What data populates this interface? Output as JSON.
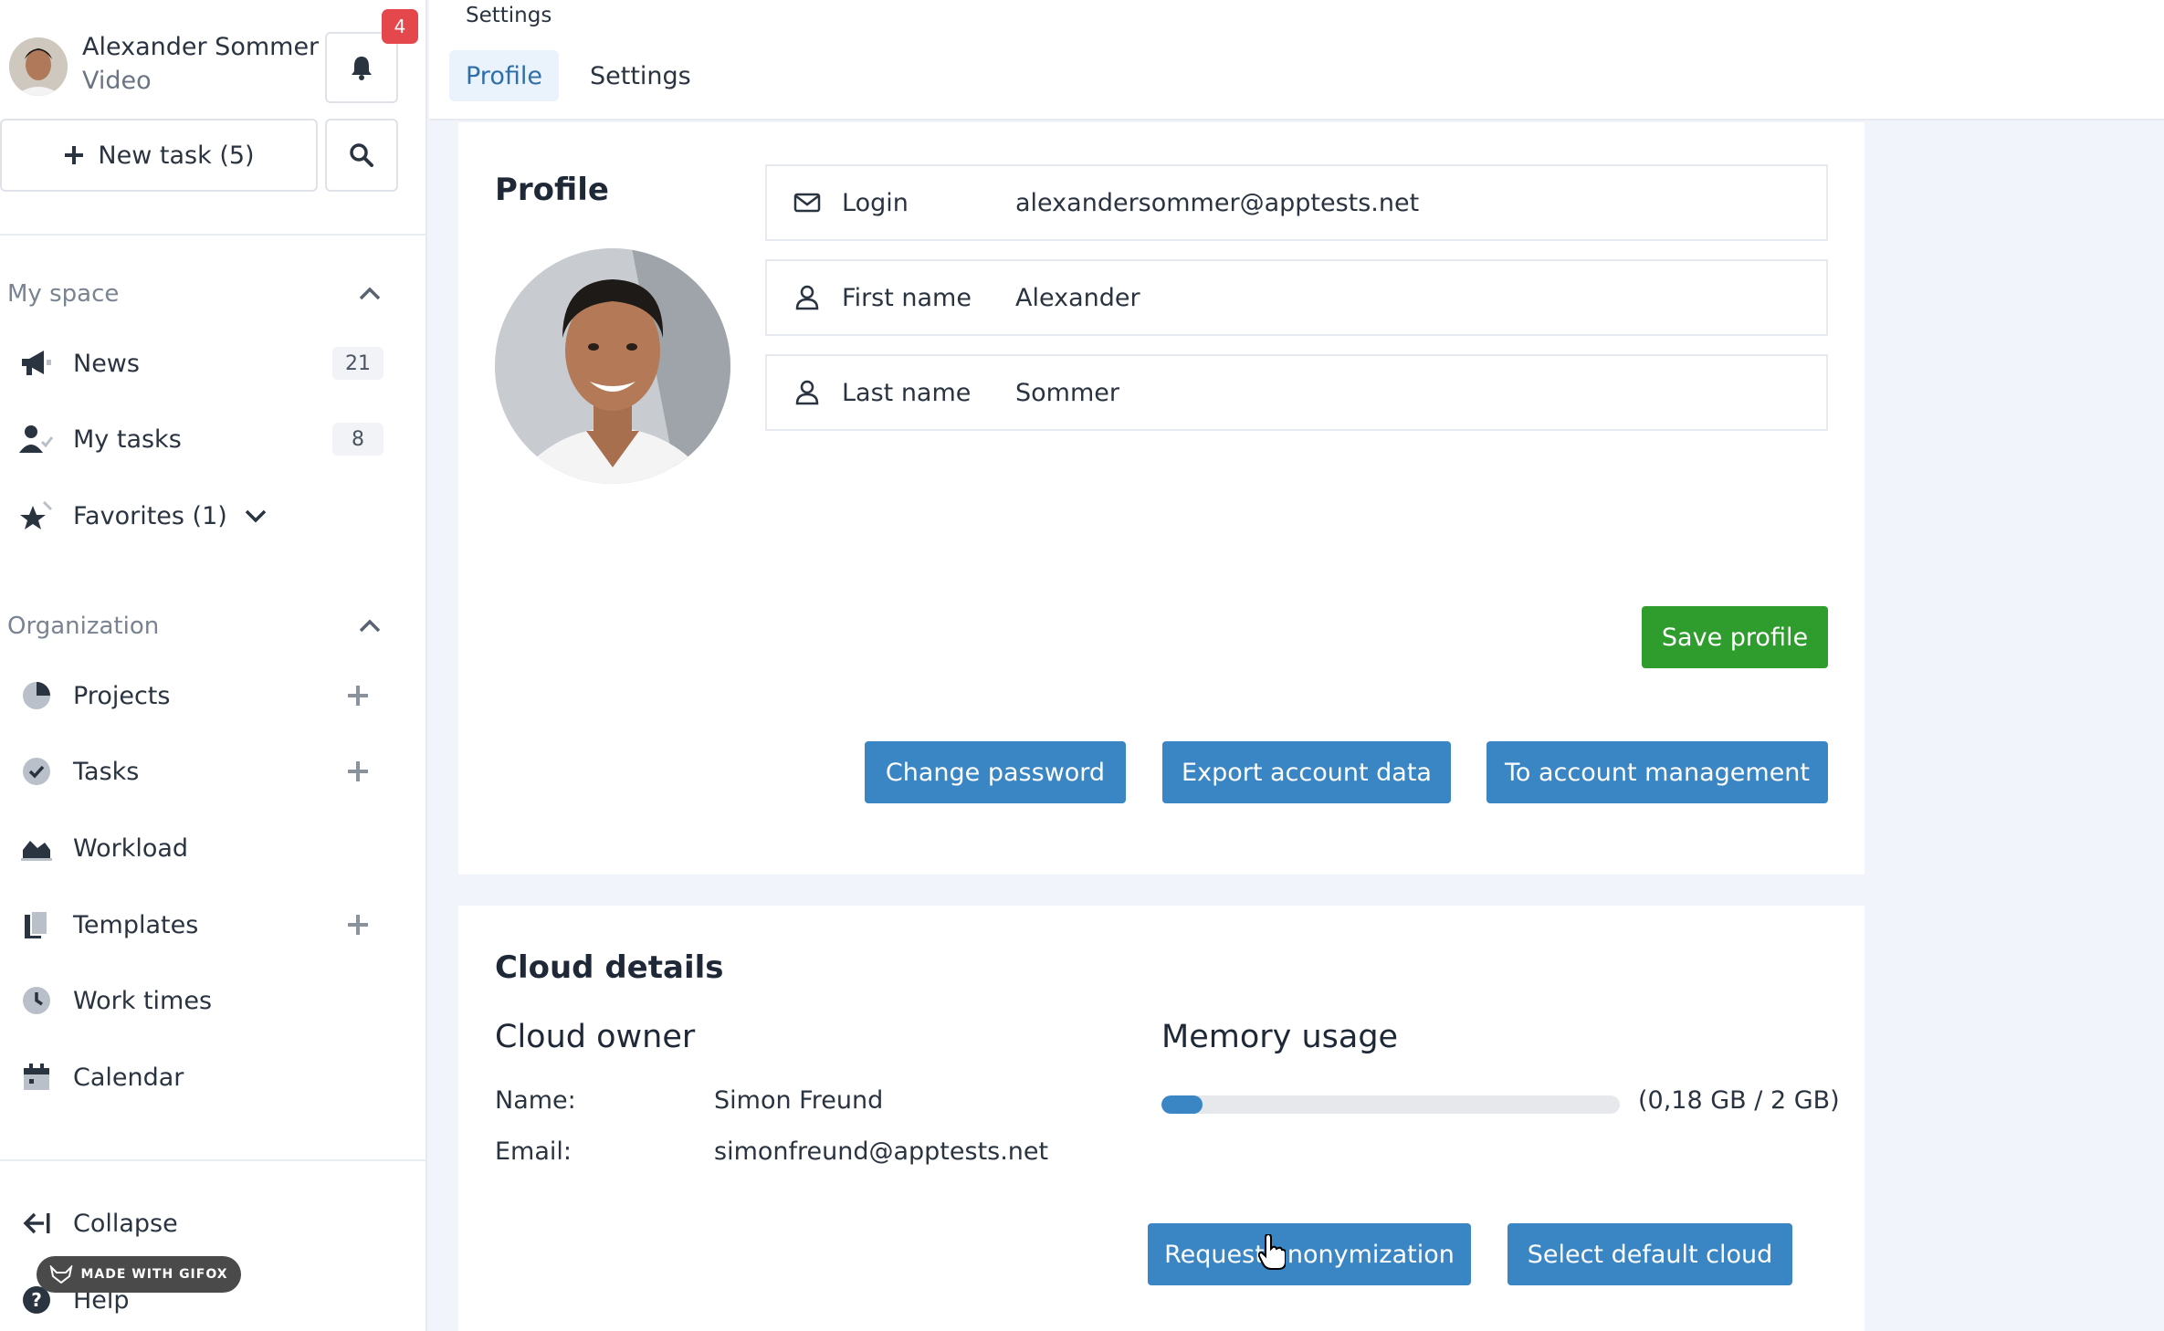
{
  "user": {
    "name": "Alexander Sommer",
    "role": "Video"
  },
  "notifications": {
    "count": "4"
  },
  "sidebar": {
    "new_task_label": "New task (5)",
    "my_space": {
      "title": "My space",
      "items": [
        {
          "label": "News",
          "icon": "megaphone-icon",
          "count": "21"
        },
        {
          "label": "My tasks",
          "icon": "user-check-icon",
          "count": "8"
        },
        {
          "label": "Favorites (1)",
          "icon": "star-icon"
        }
      ]
    },
    "organization": {
      "title": "Organization",
      "items": [
        {
          "label": "Projects",
          "icon": "pie-chart-icon"
        },
        {
          "label": "Tasks",
          "icon": "check-circle-icon"
        },
        {
          "label": "Workload",
          "icon": "area-chart-icon"
        },
        {
          "label": "Templates",
          "icon": "document-icon"
        },
        {
          "label": "Work times",
          "icon": "clock-icon"
        },
        {
          "label": "Calendar",
          "icon": "calendar-icon"
        }
      ]
    },
    "collapse_label": "Collapse",
    "help_label": "Help",
    "watermark": "MADE WITH GIFOX"
  },
  "header": {
    "breadcrumb": "Settings",
    "tabs": [
      {
        "label": "Profile",
        "active": true
      },
      {
        "label": "Settings",
        "active": false
      }
    ]
  },
  "profile": {
    "title": "Profile",
    "fields": [
      {
        "label": "Login",
        "value": "alexandersommer@apptests.net",
        "icon": "envelope-icon"
      },
      {
        "label": "First name",
        "value": "Alexander",
        "icon": "user-icon"
      },
      {
        "label": "Last name",
        "value": "Sommer",
        "icon": "user-icon"
      }
    ],
    "save_label": "Save profile",
    "change_password_label": "Change password",
    "export_label": "Export account data",
    "account_mgmt_label": "To account management"
  },
  "cloud": {
    "title": "Cloud details",
    "owner_title": "Cloud owner",
    "name_label": "Name:",
    "name_value": "Simon Freund",
    "email_label": "Email:",
    "email_value": "simonfreund@apptests.net",
    "memory_title": "Memory usage",
    "memory_text": "(0,18 GB / 2 GB)",
    "memory_fraction": 0.09,
    "anonymize_label": "Request anonymization",
    "default_cloud_label": "Select default cloud"
  },
  "colors": {
    "primary": "#3a86c4",
    "success": "#2e9d2e",
    "danger": "#e4484d"
  }
}
